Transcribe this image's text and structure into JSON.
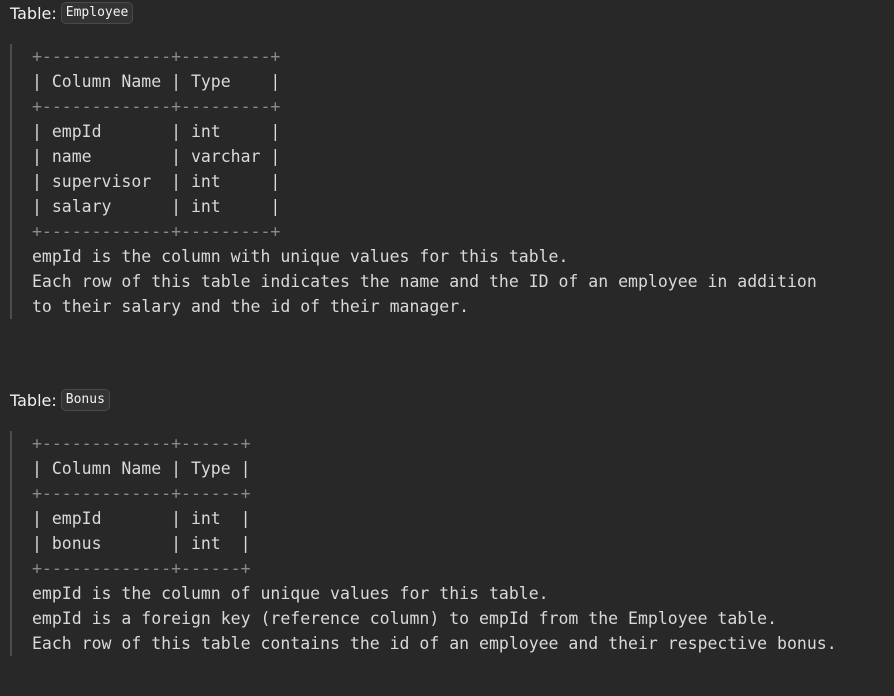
{
  "table_prefix": "Table:",
  "employee": {
    "name": "Employee",
    "schema_lines": [
      "+-------------+---------+",
      "| Column Name | Type    |",
      "+-------------+---------+",
      "| empId       | int     |",
      "| name        | varchar |",
      "| supervisor  | int     |",
      "| salary      | int     |",
      "+-------------+---------+"
    ],
    "description_lines": [
      "empId is the column with unique values for this table.",
      "Each row of this table indicates the name and the ID of an employee in addition",
      "to their salary and the id of their manager."
    ]
  },
  "bonus": {
    "name": "Bonus",
    "schema_lines": [
      "+-------------+------+",
      "| Column Name | Type |",
      "+-------------+------+",
      "| empId       | int  |",
      "| bonus       | int  |",
      "+-------------+------+"
    ],
    "description_lines": [
      "empId is the column of unique values for this table.",
      "empId is a foreign key (reference column) to empId from the Employee table.",
      "Each row of this table contains the id of an employee and their respective bonus."
    ]
  }
}
